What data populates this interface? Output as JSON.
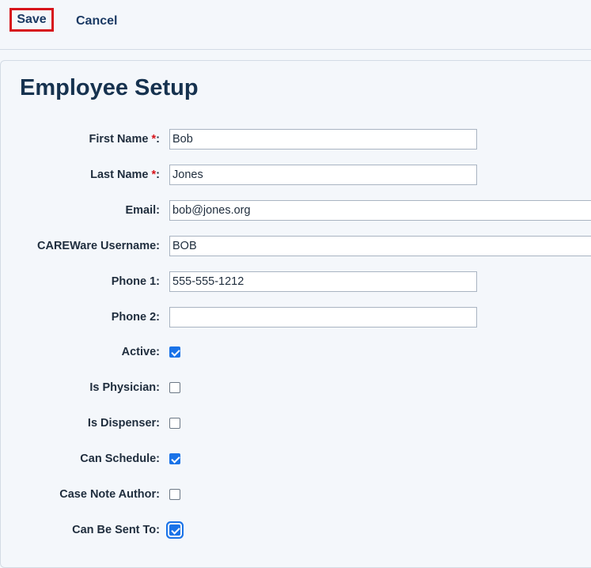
{
  "toolbar": {
    "save_label": "Save",
    "cancel_label": "Cancel"
  },
  "page": {
    "title": "Employee Setup"
  },
  "form": {
    "required_marker": "*",
    "first_name": {
      "label": "First Name ",
      "suffix": ":",
      "value": "Bob",
      "required": true
    },
    "last_name": {
      "label": "Last Name ",
      "suffix": ":",
      "value": "Jones",
      "required": true
    },
    "email": {
      "label": "Email:",
      "value": "bob@jones.org"
    },
    "careware_username": {
      "label": "CAREWare Username:",
      "value": "BOB"
    },
    "phone1": {
      "label": "Phone 1:",
      "value": "555-555-1212"
    },
    "phone2": {
      "label": "Phone 2:",
      "value": ""
    },
    "active": {
      "label": "Active:",
      "checked": true
    },
    "is_physician": {
      "label": "Is Physician:",
      "checked": false
    },
    "is_dispenser": {
      "label": "Is Dispenser:",
      "checked": false
    },
    "can_schedule": {
      "label": "Can Schedule:",
      "checked": true
    },
    "case_note_author": {
      "label": "Case Note Author:",
      "checked": false
    },
    "can_be_sent_to": {
      "label": "Can Be Sent To:",
      "checked": true,
      "focused": true
    }
  },
  "colors": {
    "accent": "#1a73e8",
    "highlight_border": "#d7141b",
    "title": "#16324f",
    "link": "#1b3a64"
  }
}
